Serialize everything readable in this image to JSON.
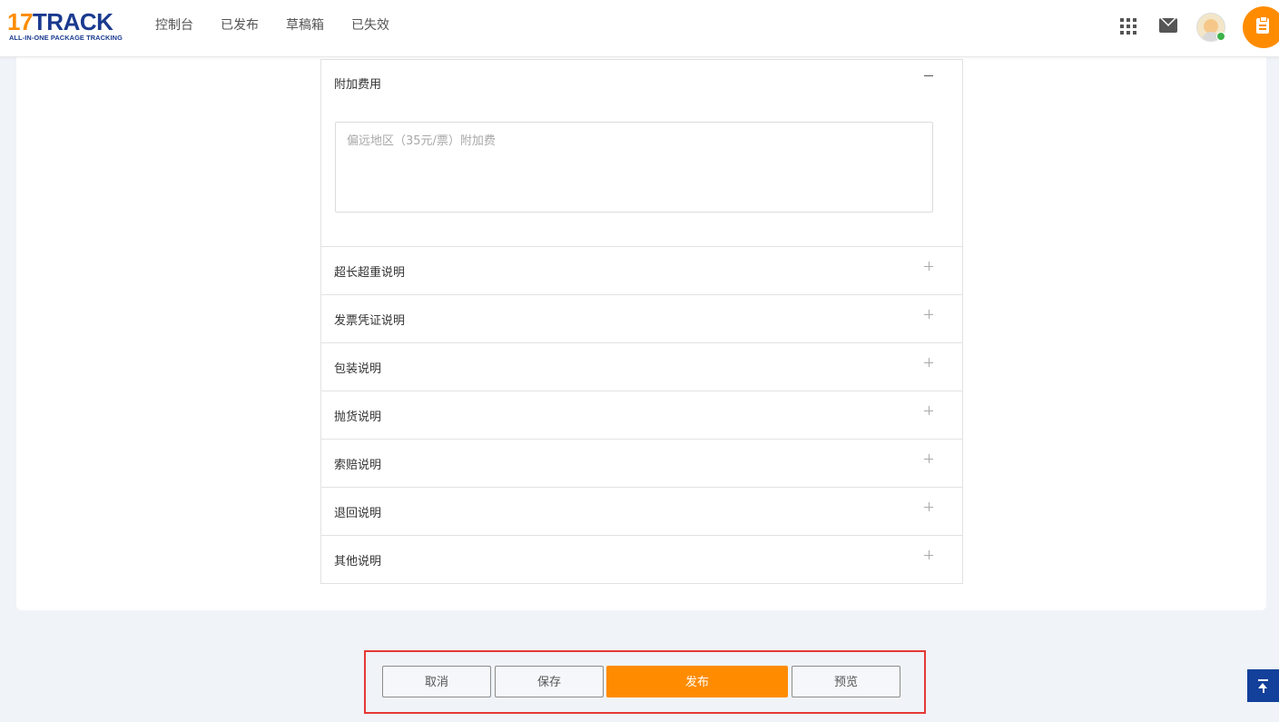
{
  "header": {
    "logo": {
      "part1": "17",
      "part2": "TRACK",
      "tagline": "ALL-IN-ONE PACKAGE TRACKING"
    },
    "nav": [
      {
        "label": "控制台"
      },
      {
        "label": "已发布"
      },
      {
        "label": "草稿箱"
      },
      {
        "label": "已失效"
      }
    ],
    "icons": [
      "apps-grid-icon",
      "mail-icon",
      "avatar",
      "clipboard-icon"
    ]
  },
  "accordion": {
    "open_section": {
      "title": "附加费用",
      "toggle": "−",
      "textarea_placeholder": "偏远地区（35元/票）附加费"
    },
    "sections": [
      {
        "label": "超长超重说明"
      },
      {
        "label": "发票凭证说明"
      },
      {
        "label": "包装说明"
      },
      {
        "label": "抛货说明"
      },
      {
        "label": "索赔说明"
      },
      {
        "label": "退回说明"
      },
      {
        "label": "其他说明"
      }
    ]
  },
  "actions": {
    "cancel": "取消",
    "save": "保存",
    "publish": "发布",
    "preview": "预览"
  },
  "colors": {
    "accent": "#ff8c00",
    "brand_blue": "#1a3a8f",
    "highlight_border": "#e53935",
    "back_to_top": "#12409a"
  }
}
